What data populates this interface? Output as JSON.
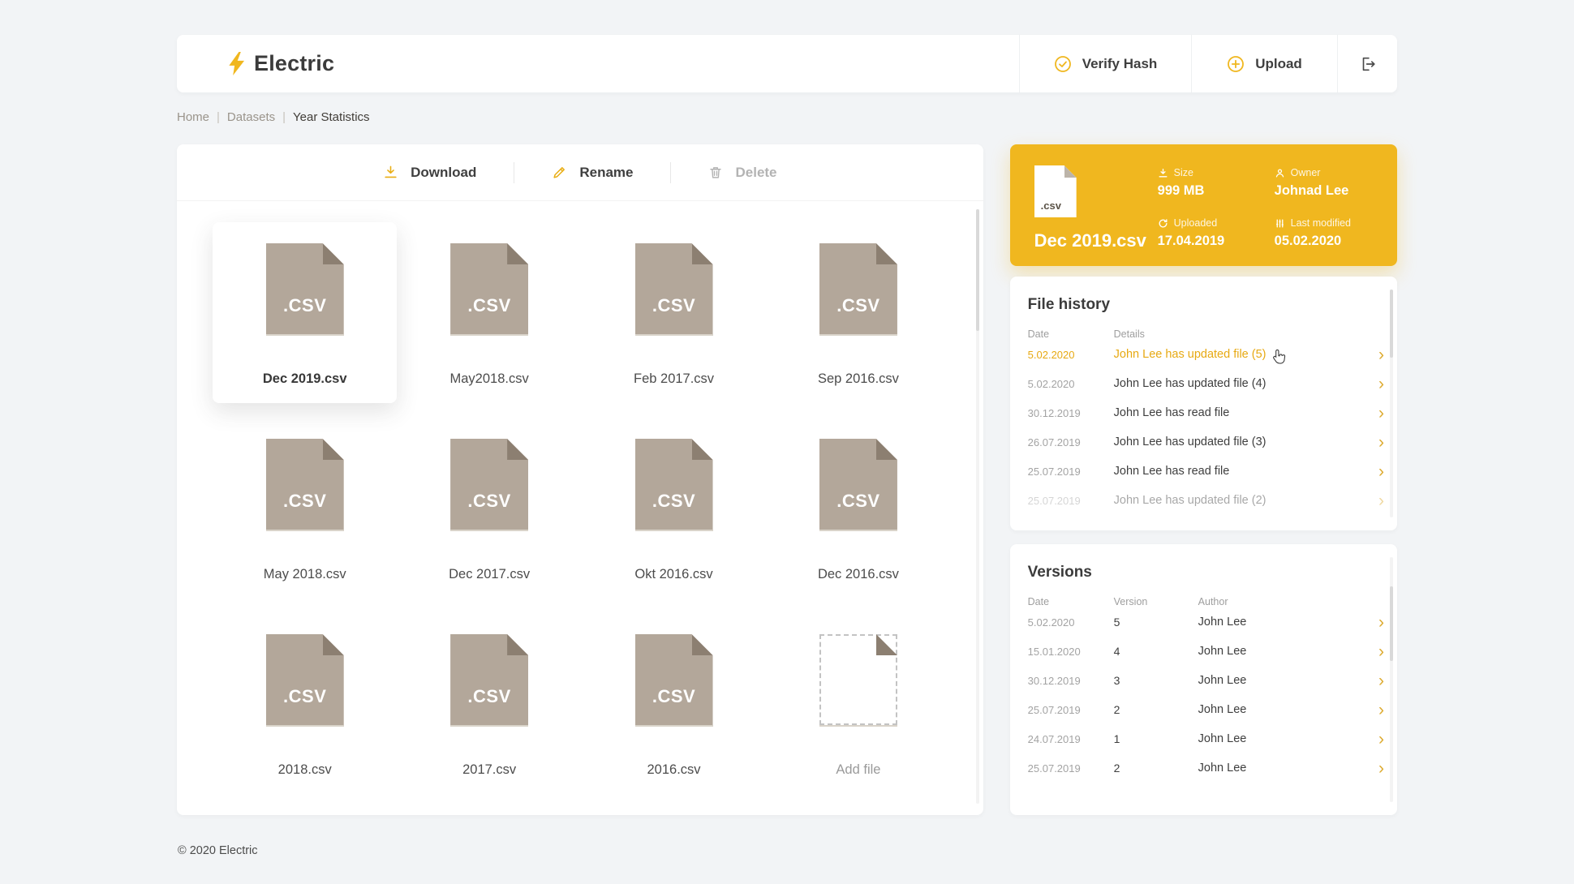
{
  "header": {
    "brand": "Electric",
    "verify_hash_label": "Verify Hash",
    "upload_label": "Upload"
  },
  "breadcrumb": {
    "items": [
      "Home",
      "Datasets"
    ],
    "separator": "|",
    "current": "Year Statistics"
  },
  "toolbar": {
    "download_label": "Download",
    "rename_label": "Rename",
    "delete_label": "Delete"
  },
  "files": {
    "ext_label": ".CSV",
    "add_file_label": "Add file",
    "items": [
      {
        "name": "Dec 2019.csv",
        "selected": true
      },
      {
        "name": "May2018.csv"
      },
      {
        "name": "Feb 2017.csv"
      },
      {
        "name": "Sep 2016.csv"
      },
      {
        "name": "May 2018.csv"
      },
      {
        "name": "Dec 2017.csv"
      },
      {
        "name": "Okt 2016.csv"
      },
      {
        "name": "Dec 2016.csv"
      },
      {
        "name": "2018.csv"
      },
      {
        "name": "2017.csv"
      },
      {
        "name": "2016.csv"
      }
    ]
  },
  "detail_card": {
    "file_name": "Dec 2019.csv",
    "ext_label": ".csv",
    "size_label": "Size",
    "size_value": "999 MB",
    "owner_label": "Owner",
    "owner_value": "Johnad Lee",
    "uploaded_label": "Uploaded",
    "uploaded_value": "17.04.2019",
    "modified_label": "Last modified",
    "modified_value": "05.02.2020"
  },
  "file_history": {
    "title": "File history",
    "col_date": "Date",
    "col_details": "Details",
    "rows": [
      {
        "date": "5.02.2020",
        "details": "John Lee has updated file (5)",
        "highlighted": true
      },
      {
        "date": "5.02.2020",
        "details": "John Lee has updated file (4)"
      },
      {
        "date": "30.12.2019",
        "details": "John Lee has read file"
      },
      {
        "date": "26.07.2019",
        "details": "John Lee has updated file (3)"
      },
      {
        "date": "25.07.2019",
        "details": "John Lee has read file"
      },
      {
        "date": "25.07.2019",
        "details": "John Lee has updated file (2)",
        "faded": true
      }
    ]
  },
  "versions": {
    "title": "Versions",
    "col_date": "Date",
    "col_version": "Version",
    "col_author": "Author",
    "rows": [
      {
        "date": "5.02.2020",
        "version": "5",
        "author": "John Lee"
      },
      {
        "date": "15.01.2020",
        "version": "4",
        "author": "John Lee"
      },
      {
        "date": "30.12.2019",
        "version": "3",
        "author": "John Lee"
      },
      {
        "date": "25.07.2019",
        "version": "2",
        "author": "John Lee"
      },
      {
        "date": "24.07.2019",
        "version": "1",
        "author": "John Lee"
      },
      {
        "date": "25.07.2019",
        "version": "2",
        "author": "John Lee"
      }
    ]
  },
  "icons": {
    "chevron": "›"
  },
  "footer": {
    "copyright": "© 2020 Electric"
  },
  "colors": {
    "accent": "#F0B71F",
    "accent_text": "#E7A912",
    "file_icon": "#B3A79A",
    "file_icon_fold": "#8C7F71",
    "background": "#F2F4F6"
  }
}
